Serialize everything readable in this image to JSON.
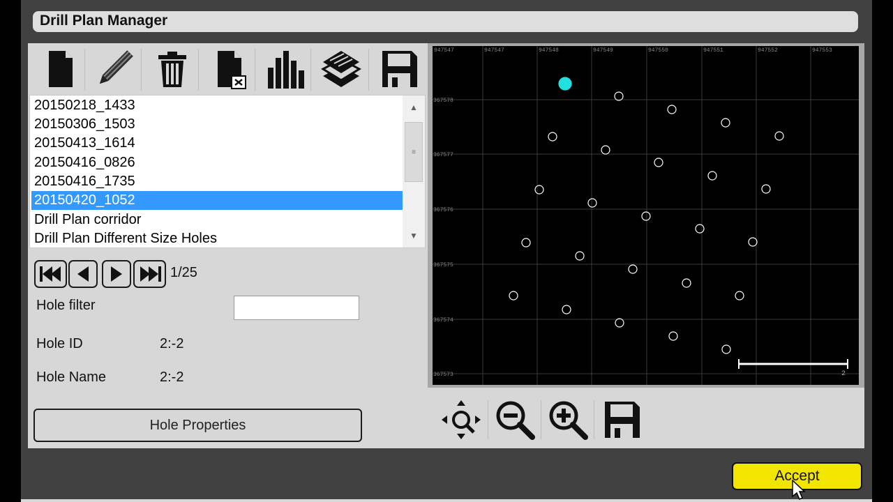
{
  "window": {
    "title": "Drill Plan Manager"
  },
  "toolbar": {
    "buttons": [
      {
        "name": "new-file-button",
        "icon": "new-file-icon"
      },
      {
        "name": "edit-button",
        "icon": "pencil-icon"
      },
      {
        "name": "delete-button",
        "icon": "trash-icon"
      },
      {
        "name": "close-file-button",
        "icon": "file-close-icon"
      },
      {
        "name": "statistics-button",
        "icon": "bar-chart-icon"
      },
      {
        "name": "layers-button",
        "icon": "layers-icon"
      },
      {
        "name": "save-button",
        "icon": "floppy-disk-icon"
      }
    ]
  },
  "plan_list": {
    "items": [
      {
        "label": "20150218_1433",
        "selected": false
      },
      {
        "label": "20150306_1503",
        "selected": false
      },
      {
        "label": "20150413_1614",
        "selected": false
      },
      {
        "label": "20150416_0826",
        "selected": false
      },
      {
        "label": "20150416_1735",
        "selected": false
      },
      {
        "label": "20150420_1052",
        "selected": true
      },
      {
        "label": "Drill Plan corridor",
        "selected": false
      },
      {
        "label": "Drill Plan Different Size Holes",
        "selected": false
      }
    ]
  },
  "navigation": {
    "page_counter": "1/25",
    "buttons": [
      "first-icon",
      "previous-icon",
      "next-icon",
      "last-icon"
    ]
  },
  "hole": {
    "filter_label": "Hole filter",
    "filter_value": "",
    "id_label": "Hole ID",
    "id_value": "2:-2",
    "name_label": "Hole Name",
    "name_value": "2:-2",
    "properties_button": "Hole Properties"
  },
  "map": {
    "x_ticks": [
      "947547",
      "947547",
      "947548",
      "947549",
      "947550",
      "947551",
      "947552",
      "947553"
    ],
    "y_ticks": [
      "367578",
      "367577",
      "367576",
      "367575",
      "367574",
      "367573"
    ],
    "scale_label": "2",
    "selected_color": "#20e0e0",
    "hole_color": "#ffffff"
  },
  "map_tools": [
    {
      "name": "pan-button",
      "icon": "move-icon"
    },
    {
      "name": "zoom-out-button",
      "icon": "zoom-out-icon"
    },
    {
      "name": "zoom-in-button",
      "icon": "zoom-in-icon"
    },
    {
      "name": "save-map-button",
      "icon": "floppy-disk-icon"
    }
  ],
  "footer": {
    "accept_label": "Accept"
  }
}
